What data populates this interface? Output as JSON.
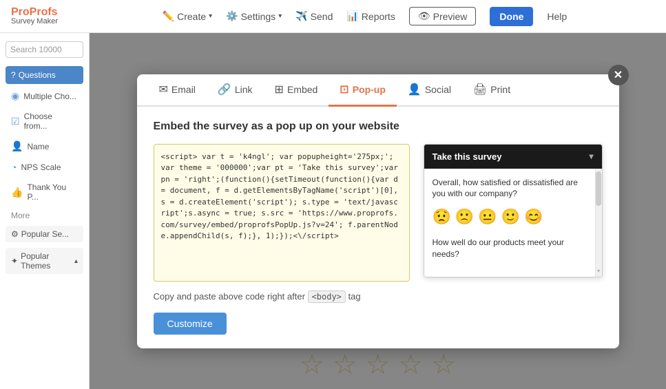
{
  "nav": {
    "logo": "Pro Profs",
    "logo_line1": "ProProfs",
    "logo_line2": "Survey Maker",
    "items": [
      {
        "label": "Create",
        "icon": "✏️"
      },
      {
        "label": "Settings",
        "icon": "⚙️"
      },
      {
        "label": "Send",
        "icon": "✈️"
      },
      {
        "label": "Reports",
        "icon": "📊"
      }
    ],
    "preview_label": "Preview",
    "done_label": "Done",
    "help_label": "Help"
  },
  "sidebar": {
    "search_placeholder": "Search 10000",
    "section_label": "Questions",
    "items": [
      {
        "label": "Multiple Cho...",
        "icon": "◉"
      },
      {
        "label": "Choose from...",
        "icon": "☑"
      },
      {
        "label": "Name",
        "icon": "👤"
      },
      {
        "label": "NPS Scale",
        "icon": "◔"
      },
      {
        "label": "Thank You P...",
        "icon": "👍"
      }
    ],
    "more_label": "More",
    "popular_sets_label": "Popular Se...",
    "popular_themes_label": "Popular Themes"
  },
  "modal": {
    "tabs": [
      {
        "id": "email",
        "label": "Email",
        "icon": "✉"
      },
      {
        "id": "link",
        "label": "Link",
        "icon": "🔗"
      },
      {
        "id": "embed",
        "label": "Embed",
        "icon": "⊞"
      },
      {
        "id": "popup",
        "label": "Pop-up",
        "icon": "⊡",
        "active": true
      },
      {
        "id": "social",
        "label": "Social",
        "icon": "👤"
      },
      {
        "id": "print",
        "label": "Print",
        "icon": "🖨"
      }
    ],
    "title": "Embed the survey as a pop up on your website",
    "code": "<script> var t = 'k4ngl'; var popupheight='275px;'; var theme = '000000';var pt = 'Take this survey';var pn = 'right';(function(){setTimeout(function(){var d = document, f = d.getElementsByTagName('script')[0], s = d.createElement('script'); s.type = 'text/javascript';s.async = true; s.src = 'https://www.proprofs.com/survey/embed/proprofsPopUp.js?v=24'; f.parentNode.appendChild(s, f);}, 1);});<\\/script>",
    "copy_note": "Copy and paste above code right after",
    "body_tag": "<body>",
    "copy_suffix": "tag",
    "preview": {
      "header": "Take this survey",
      "q1": "Overall, how satisfied or dissatisfied are you with our company?",
      "q2": "How well do our products meet your needs?",
      "emojis": [
        "😟",
        "🙁",
        "😐",
        "🙂",
        "😊"
      ]
    },
    "customize_label": "Customize",
    "close_icon": "✕"
  },
  "stars": [
    "★",
    "★",
    "★",
    "★",
    "★"
  ]
}
